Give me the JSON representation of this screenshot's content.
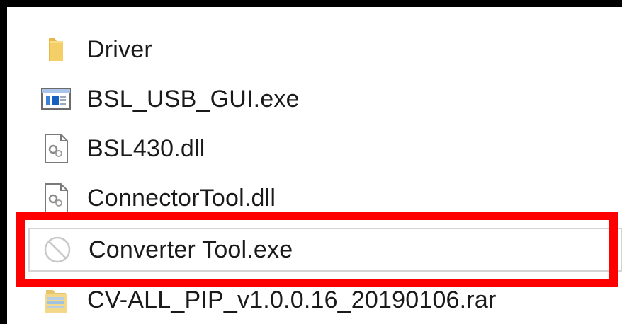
{
  "files": [
    {
      "name": "Driver",
      "icon": "folder-icon"
    },
    {
      "name": "BSL_USB_GUI.exe",
      "icon": "application-window-icon"
    },
    {
      "name": "BSL430.dll",
      "icon": "dll-gear-file-icon"
    },
    {
      "name": "ConnectorTool.dll",
      "icon": "dll-gear-file-icon"
    },
    {
      "name": "Converter Tool.exe",
      "icon": "blocked-executable-icon"
    },
    {
      "name": "CV-ALL_PIP_v1.0.0.16_20190106.rar",
      "icon": "rar-archive-icon"
    }
  ],
  "highlight": {
    "color": "#ff0000",
    "target": "Converter Tool.exe"
  }
}
